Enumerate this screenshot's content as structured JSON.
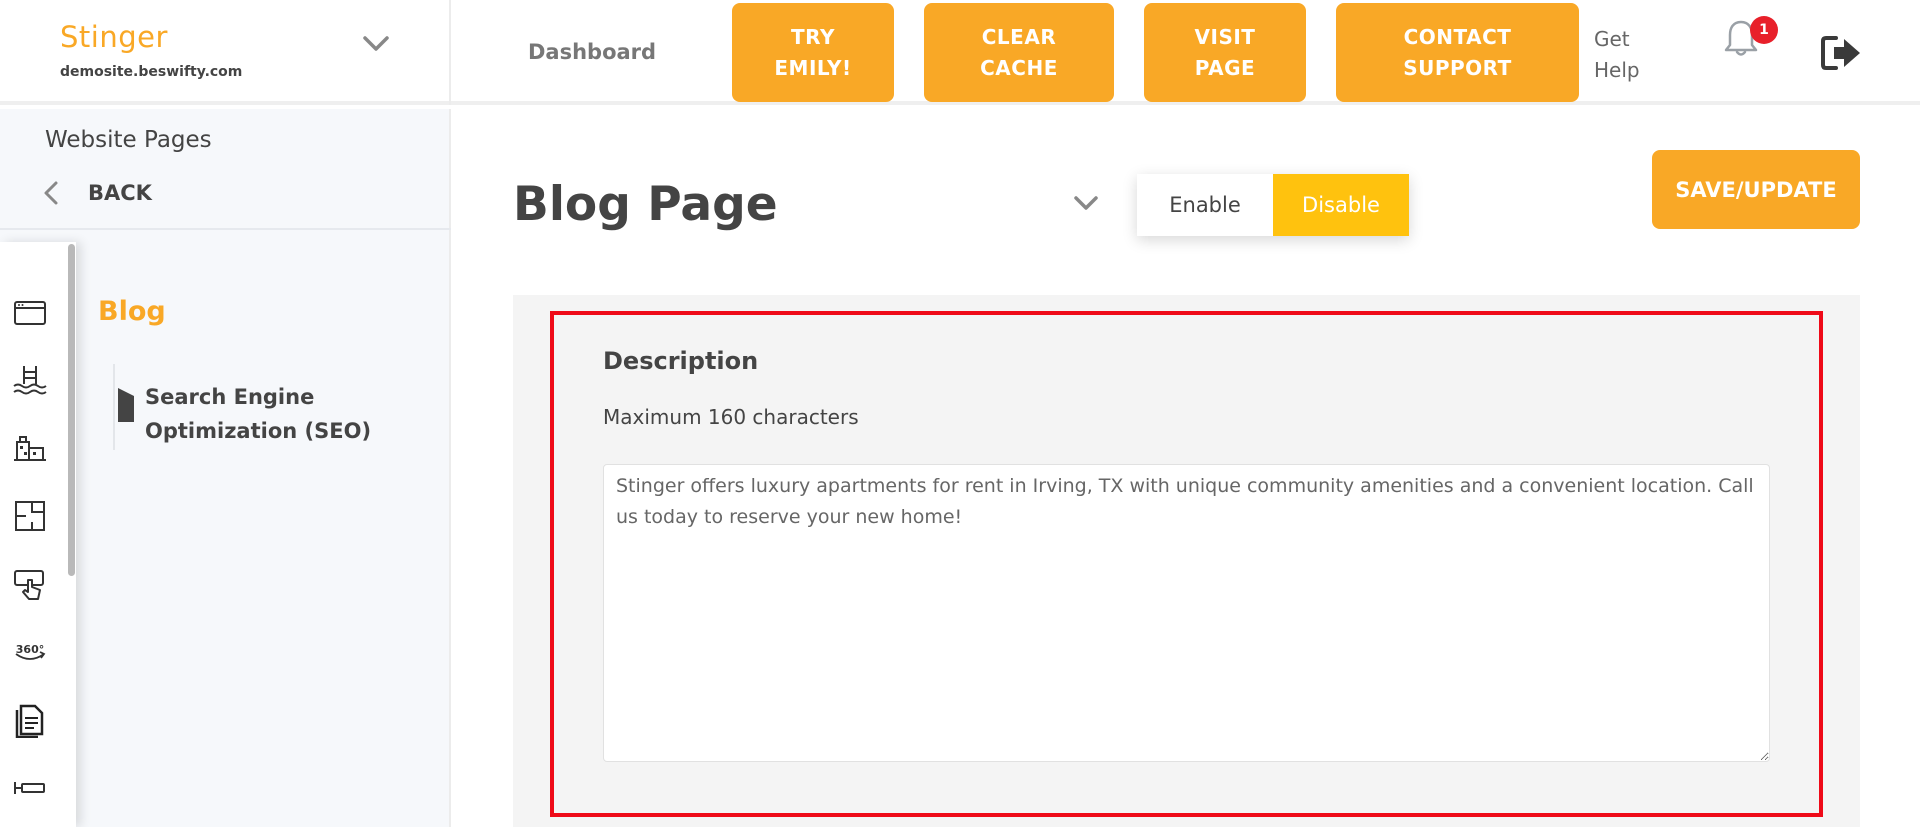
{
  "header": {
    "brand_name": "Stinger",
    "brand_domain": "demosite.beswifty.com",
    "dashboard_label": "Dashboard",
    "buttons": [
      {
        "label": "TRY\nEMILY!"
      },
      {
        "label": "CLEAR\nCACHE"
      },
      {
        "label": "VISIT\nPAGE"
      },
      {
        "label": "CONTACT\nSUPPORT"
      }
    ],
    "get_help_label": "Get\nHelp",
    "notification_count": "1",
    "icons": {
      "site_switcher": "chevron-down-icon",
      "notifications": "bell-icon",
      "logout": "logout-icon"
    }
  },
  "sidebar": {
    "title": "Website Pages",
    "back_label": "BACK",
    "section_title": "Blog",
    "subnav": [
      {
        "label": "Search Engine Optimization (SEO)"
      }
    ],
    "rail_icons": [
      "browser-window-icon",
      "pool-icon",
      "buildings-icon",
      "floorplan-icon",
      "touch-screen-icon",
      "360-view-icon",
      "document-icon",
      "key-tag-icon"
    ]
  },
  "main": {
    "page_title": "Blog Page",
    "toggle": {
      "enable_label": "Enable",
      "disable_label": "Disable",
      "selected": "Disable"
    },
    "save_label": "SAVE/UPDATE",
    "description": {
      "label": "Description",
      "hint": "Maximum 160 characters",
      "value": "Stinger offers luxury apartments for rent in Irving, TX with unique community amenities and a convenient location. Call us today to reserve your new home!"
    }
  },
  "colors": {
    "accent": "#f9a826",
    "toggle_active": "#ffc20e",
    "highlight": "#ef0a18",
    "badge": "#e8202a"
  }
}
